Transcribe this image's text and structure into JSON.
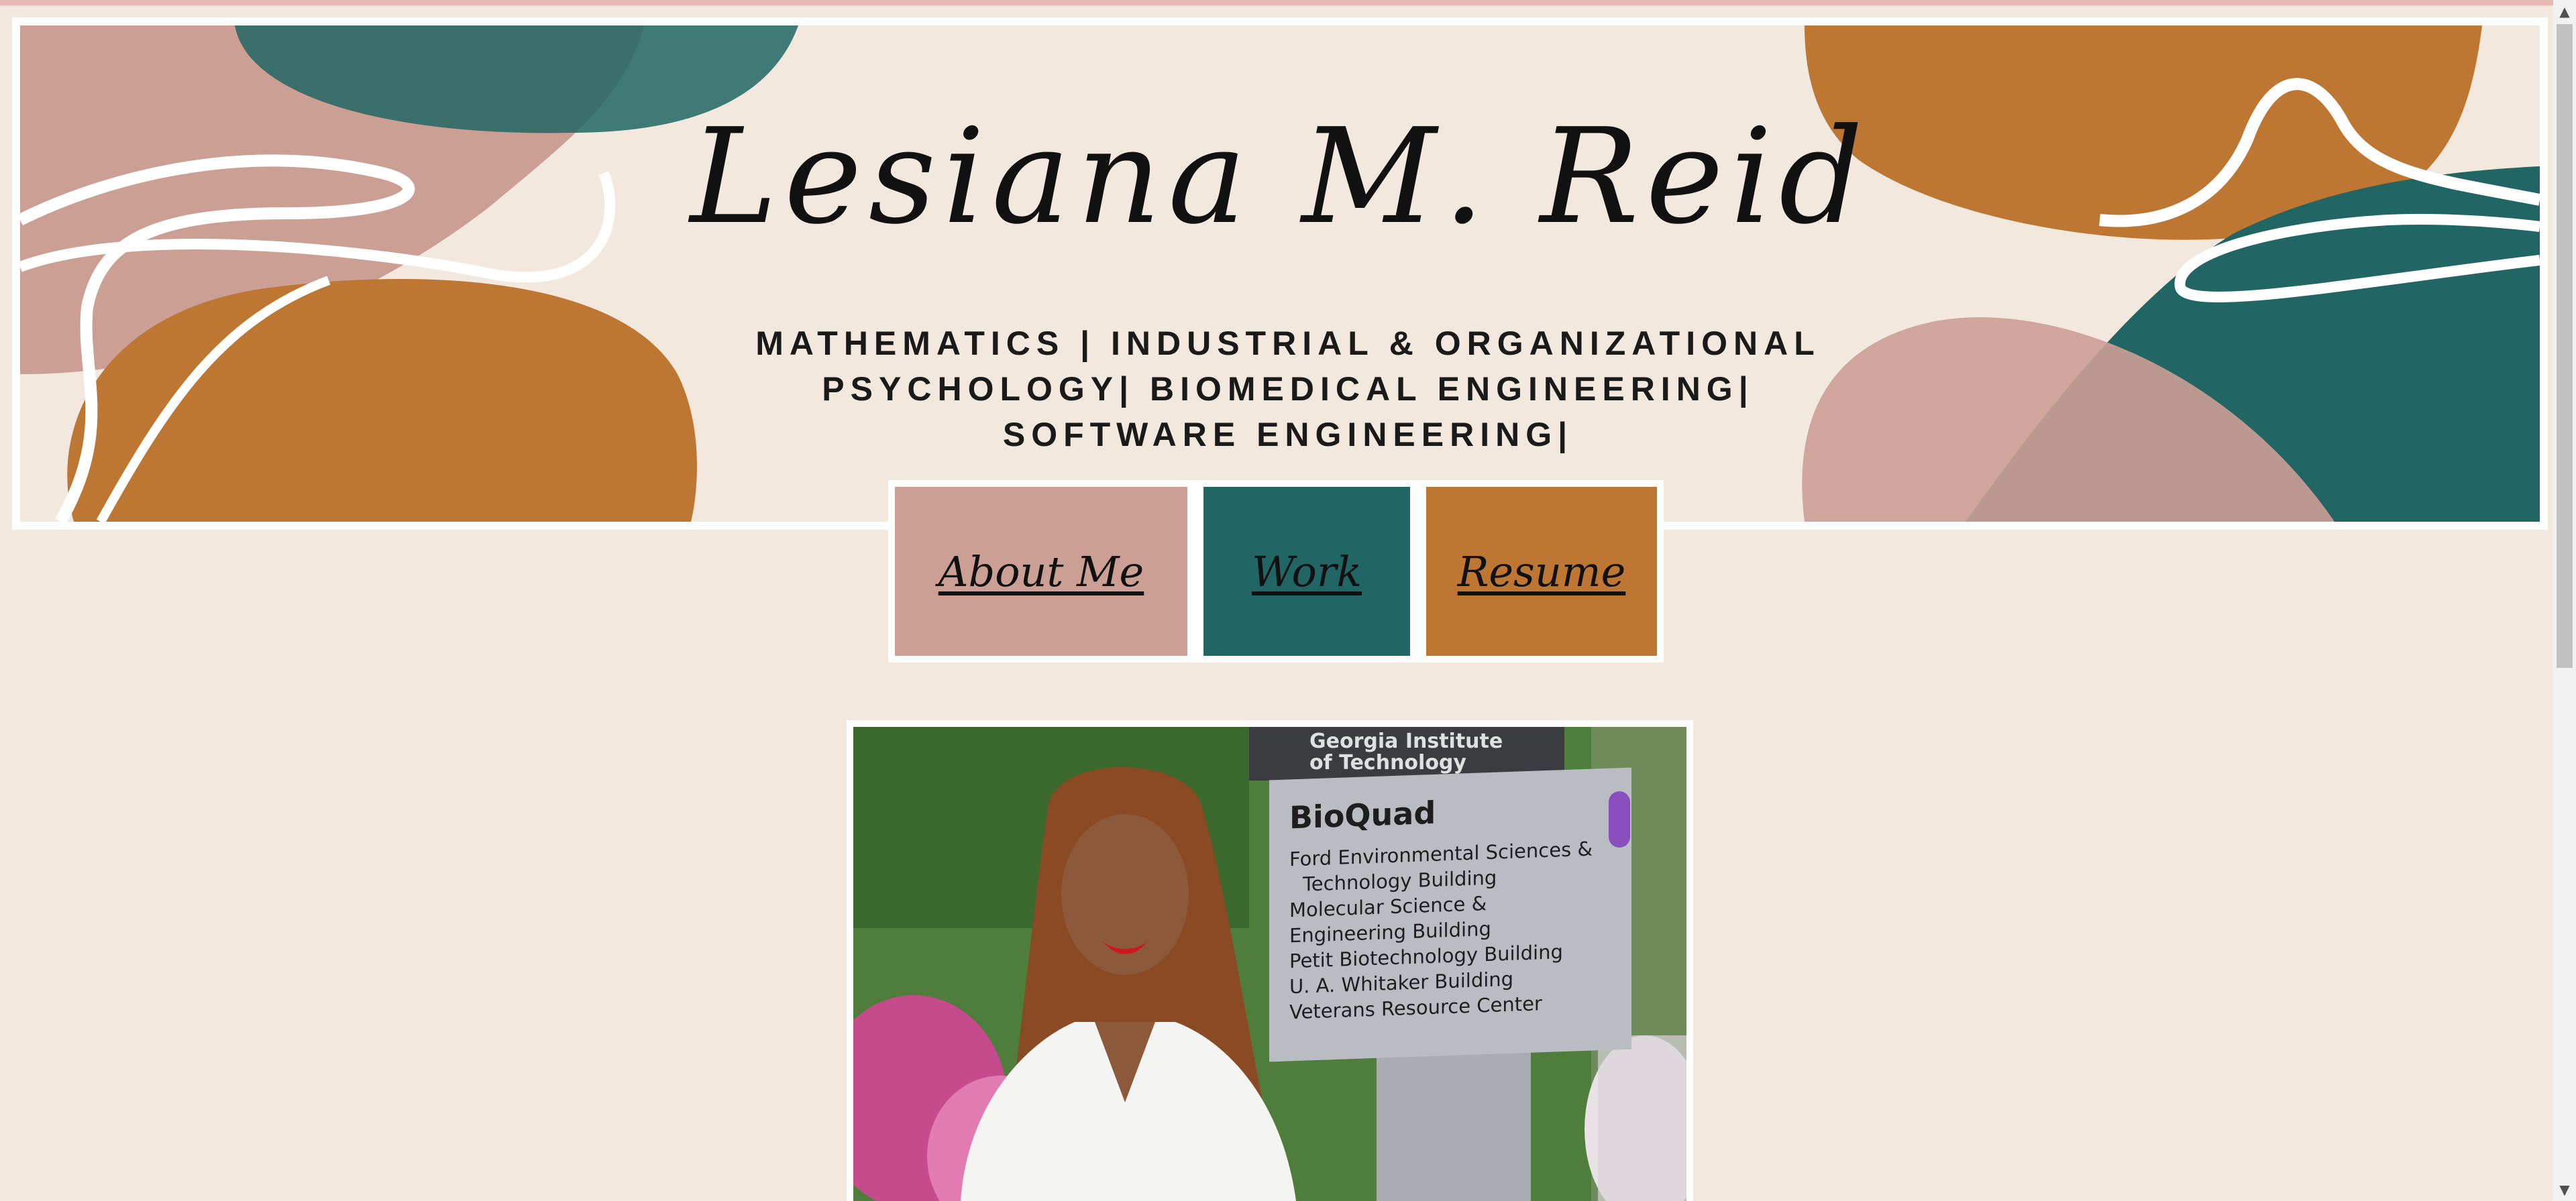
{
  "header": {
    "title": "Lesiana M. Reid",
    "subtitle_lines": [
      "MATHEMATICS | INDUSTRIAL & ORGANIZATIONAL",
      "PSYCHOLOGY| BIOMEDICAL ENGINEERING|",
      "SOFTWARE ENGINEERING|"
    ]
  },
  "nav": {
    "about": "About Me",
    "work": "Work",
    "resume": "Resume"
  },
  "photo": {
    "sign_header_lines": [
      "Georgia Institute",
      "of Technology"
    ],
    "sign_title": "BioQuad",
    "sign_lines": [
      "Ford Environmental Sciences &",
      "  Technology Building",
      "Molecular Science &",
      "Engineering Building",
      "Petit  Biotechnology Building",
      "U. A. Whitaker Building",
      "Veterans Resource Center"
    ]
  },
  "colors": {
    "background": "#f2e8de",
    "pink": "#cc9f95",
    "teal": "#216664",
    "ochre": "#bd7733"
  },
  "icons": {
    "scroll_up": "triangle-up-icon",
    "scroll_down": "triangle-down-icon"
  }
}
